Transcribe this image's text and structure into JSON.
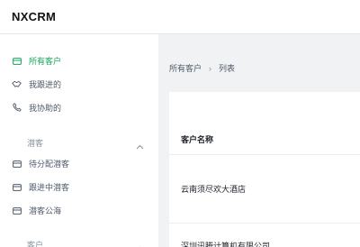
{
  "app": {
    "logo": "NXCRM"
  },
  "sidebar": {
    "items": [
      {
        "label": "所有客户",
        "icon": "folder-icon",
        "active": true
      },
      {
        "label": "我跟进的",
        "icon": "handshake-icon"
      },
      {
        "label": "我协助的",
        "icon": "phone-icon"
      }
    ],
    "groups": [
      {
        "label": "潜客",
        "expanded": true,
        "items": [
          {
            "label": "待分配潜客",
            "icon": "folder-icon"
          },
          {
            "label": "跟进中潜客",
            "icon": "folder-icon"
          },
          {
            "label": "潜客公海",
            "icon": "folder-icon"
          }
        ]
      },
      {
        "label": "客户",
        "expanded": true
      }
    ]
  },
  "breadcrumb": {
    "parent": "所有客户",
    "separator": "›",
    "current": "列表"
  },
  "table": {
    "columns": [
      "客户名称"
    ],
    "rows": [
      {
        "name": "云南须尽欢大酒店"
      },
      {
        "name": "深圳讯腾计算机有限公司"
      }
    ]
  },
  "colors": {
    "accent": "#16a35a",
    "text": "#1f2329",
    "muted": "#86909c"
  }
}
